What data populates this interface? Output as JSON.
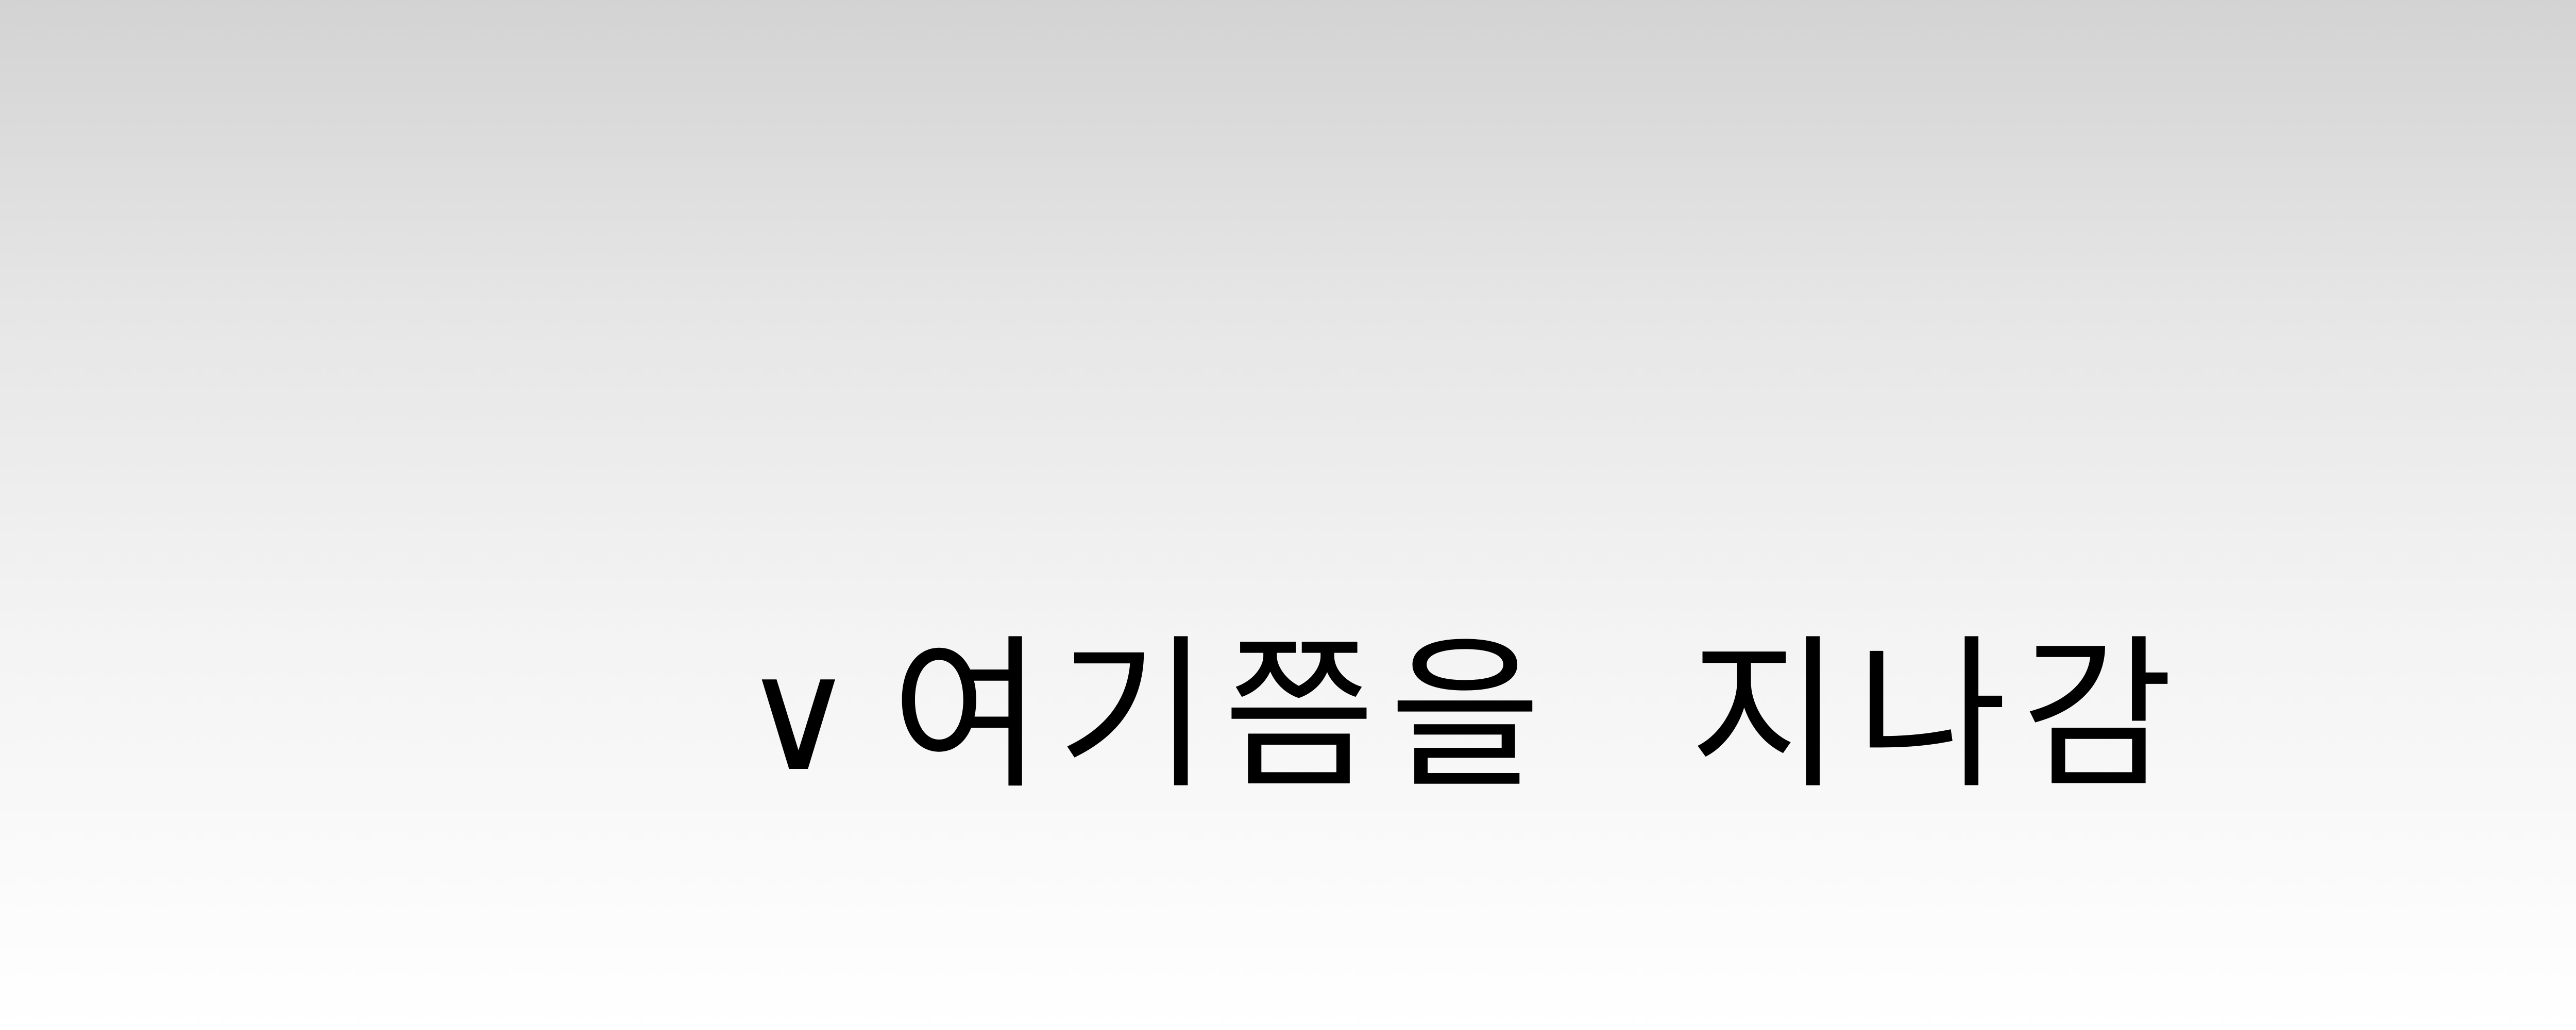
{
  "caption": {
    "mark": "∨",
    "phrase_1": "여기쯤을",
    "phrase_2": "지나감"
  }
}
